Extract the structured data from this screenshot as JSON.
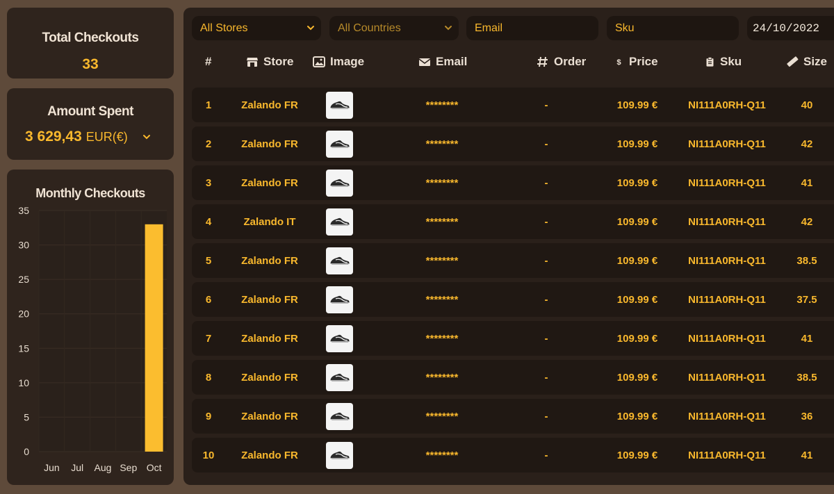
{
  "stats": {
    "total_checkouts_label": "Total Checkouts",
    "total_checkouts_value": "33",
    "amount_spent_label": "Amount Spent",
    "amount_spent_value": "3 629,43",
    "amount_spent_currency": "EUR(€)"
  },
  "chart_data": {
    "type": "bar",
    "title": "Monthly Checkouts",
    "categories": [
      "Jun",
      "Jul",
      "Aug",
      "Sep",
      "Oct"
    ],
    "values": [
      0,
      0,
      0,
      0,
      33
    ],
    "ylim": [
      0,
      35
    ],
    "yticks": [
      "35",
      "30",
      "25",
      "20",
      "15",
      "10",
      "5",
      "0"
    ],
    "grid": true,
    "bar_color": "#fbbd2f"
  },
  "filters": {
    "stores": "All Stores",
    "countries": "All Countries",
    "email_placeholder": "Email",
    "sku_placeholder": "Sku",
    "date": "24/10/2022"
  },
  "table": {
    "headers": {
      "num": "#",
      "store": "Store",
      "image": "Image",
      "email": "Email",
      "order": "Order",
      "price": "Price",
      "sku": "Sku",
      "size": "Size"
    },
    "rows": [
      {
        "num": "1",
        "store": "Zalando FR",
        "email": "********",
        "order": "-",
        "price": "109.99 €",
        "sku": "NI111A0RH-Q11",
        "size": "40"
      },
      {
        "num": "2",
        "store": "Zalando FR",
        "email": "********",
        "order": "-",
        "price": "109.99 €",
        "sku": "NI111A0RH-Q11",
        "size": "42"
      },
      {
        "num": "3",
        "store": "Zalando FR",
        "email": "********",
        "order": "-",
        "price": "109.99 €",
        "sku": "NI111A0RH-Q11",
        "size": "41"
      },
      {
        "num": "4",
        "store": "Zalando IT",
        "email": "********",
        "order": "-",
        "price": "109.99 €",
        "sku": "NI111A0RH-Q11",
        "size": "42"
      },
      {
        "num": "5",
        "store": "Zalando FR",
        "email": "********",
        "order": "-",
        "price": "109.99 €",
        "sku": "NI111A0RH-Q11",
        "size": "38.5"
      },
      {
        "num": "6",
        "store": "Zalando FR",
        "email": "********",
        "order": "-",
        "price": "109.99 €",
        "sku": "NI111A0RH-Q11",
        "size": "37.5"
      },
      {
        "num": "7",
        "store": "Zalando FR",
        "email": "********",
        "order": "-",
        "price": "109.99 €",
        "sku": "NI111A0RH-Q11",
        "size": "41"
      },
      {
        "num": "8",
        "store": "Zalando FR",
        "email": "********",
        "order": "-",
        "price": "109.99 €",
        "sku": "NI111A0RH-Q11",
        "size": "38.5"
      },
      {
        "num": "9",
        "store": "Zalando FR",
        "email": "********",
        "order": "-",
        "price": "109.99 €",
        "sku": "NI111A0RH-Q11",
        "size": "36"
      },
      {
        "num": "10",
        "store": "Zalando FR",
        "email": "********",
        "order": "-",
        "price": "109.99 €",
        "sku": "NI111A0RH-Q11",
        "size": "41"
      }
    ]
  },
  "colors": {
    "accent": "#f9b82d",
    "background": "#5e4a3a",
    "card": "#2f241d",
    "row": "#201813"
  }
}
